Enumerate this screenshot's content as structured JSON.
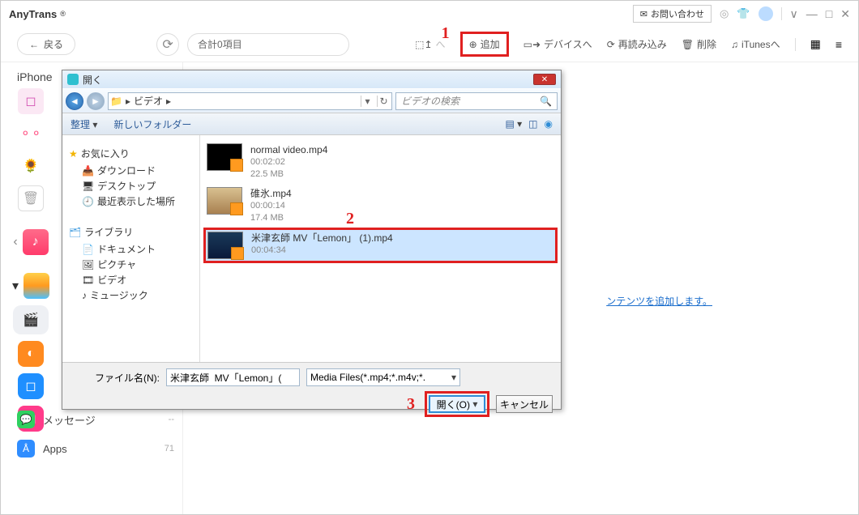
{
  "app": {
    "name": "AnyTrans",
    "reg": "®"
  },
  "header": {
    "inquiry": "お問い合わせ"
  },
  "toolbar": {
    "back": "戻る",
    "summary": "合計0項目",
    "add": "追加",
    "toDevice": "デバイスへ",
    "reload": "再読み込み",
    "delete": "削除",
    "toItunes": "iTunesへ"
  },
  "device": {
    "name": "iPhone"
  },
  "sidebar_lower": {
    "messages": {
      "label": "メッセージ",
      "count": "--"
    },
    "apps": {
      "label": "Apps",
      "count": "71"
    }
  },
  "hint": "ンテンツを追加します。",
  "dialog": {
    "title": "開く",
    "path": "ビデオ",
    "search_placeholder": "ビデオの検索",
    "organize": "整理",
    "new_folder": "新しいフォルダー",
    "tree": {
      "fav": "お気に入り",
      "downloads": "ダウンロード",
      "desktop": "デスクトップ",
      "recent": "最近表示した場所",
      "library": "ライブラリ",
      "documents": "ドキュメント",
      "pictures": "ピクチャ",
      "videos": "ビデオ",
      "music": "ミュージック"
    },
    "files": [
      {
        "name": "normal video.mp4",
        "duration": "00:02:02",
        "size": "22.5 MB"
      },
      {
        "name": "碓氷.mp4",
        "duration": "00:00:14",
        "size": "17.4 MB"
      },
      {
        "name": "米津玄師  MV「Lemon」 (1).mp4",
        "duration": "00:04:34",
        "size": ""
      }
    ],
    "filename_label": "ファイル名(N):",
    "filename_value": "米津玄師  MV「Lemon」(",
    "type_filter": "Media Files(*.mp4;*.m4v;*.",
    "open_btn": "開く(O)",
    "cancel_btn": "キャンセル"
  },
  "markers": {
    "m1": "1",
    "m2": "2",
    "m3": "3"
  }
}
